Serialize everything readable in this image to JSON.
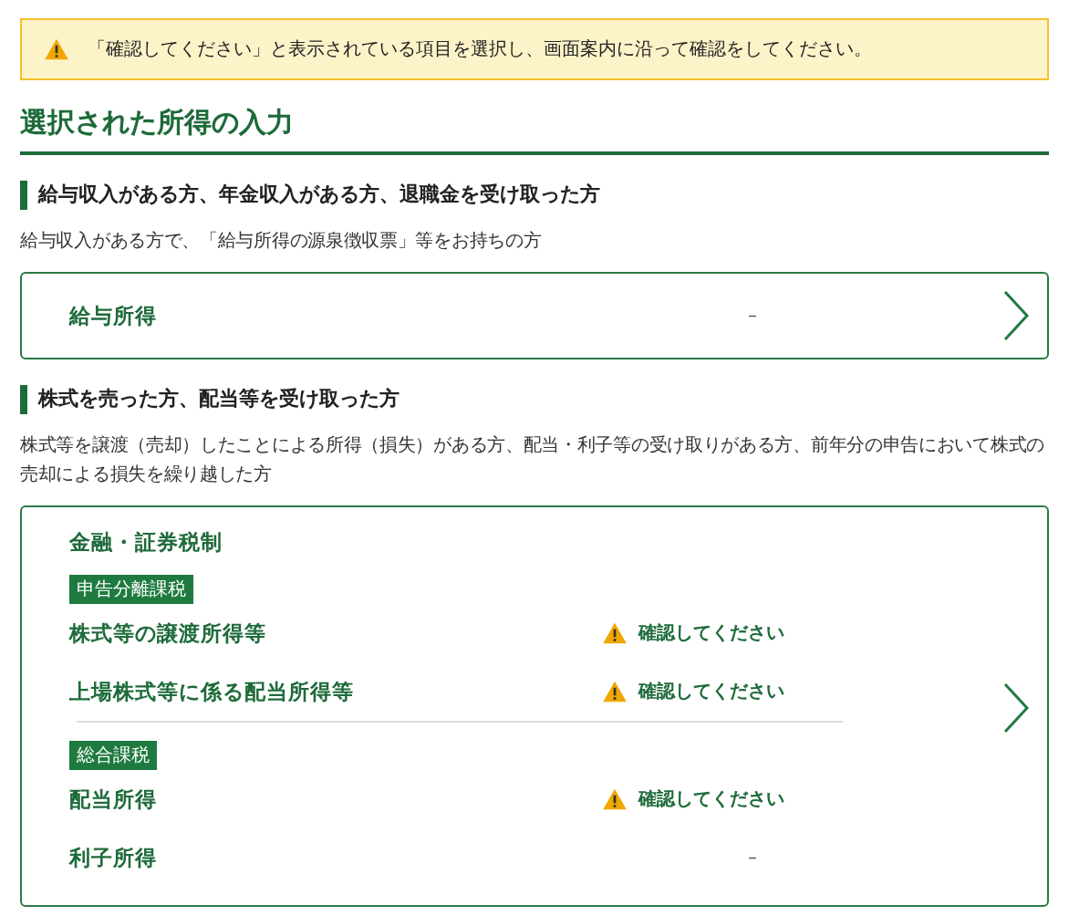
{
  "alert": {
    "text": "「確認してください」と表示されている項目を選択し、画面案内に沿って確認をしてください。"
  },
  "title": "選択された所得の入力",
  "sections": [
    {
      "heading": "給与収入がある方、年金収入がある方、退職金を受け取った方",
      "description": "給与収入がある方で、「給与所得の源泉徴収票」等をお持ちの方",
      "card": {
        "kind": "single",
        "label": "給与所得",
        "status": {
          "kind": "none",
          "text": "–"
        }
      }
    },
    {
      "heading": "株式を売った方、配当等を受け取った方",
      "description": "株式等を譲渡（売却）したことによる所得（損失）がある方、配当・利子等の受け取りがある方、前年分の申告において株式の売却による損失を繰り越した方",
      "card": {
        "kind": "grouped",
        "title": "金融・証券税制",
        "groups": [
          {
            "tag": "申告分離課税",
            "rows": [
              {
                "label": "株式等の譲渡所得等",
                "status": {
                  "kind": "warning",
                  "text": "確認してください"
                }
              },
              {
                "label": "上場株式等に係る配当所得等",
                "status": {
                  "kind": "warning",
                  "text": "確認してください"
                }
              }
            ]
          },
          {
            "tag": "総合課税",
            "rows": [
              {
                "label": "配当所得",
                "status": {
                  "kind": "warning",
                  "text": "確認してください"
                }
              },
              {
                "label": "利子所得",
                "status": {
                  "kind": "none",
                  "text": "–"
                }
              }
            ]
          }
        ]
      }
    }
  ]
}
